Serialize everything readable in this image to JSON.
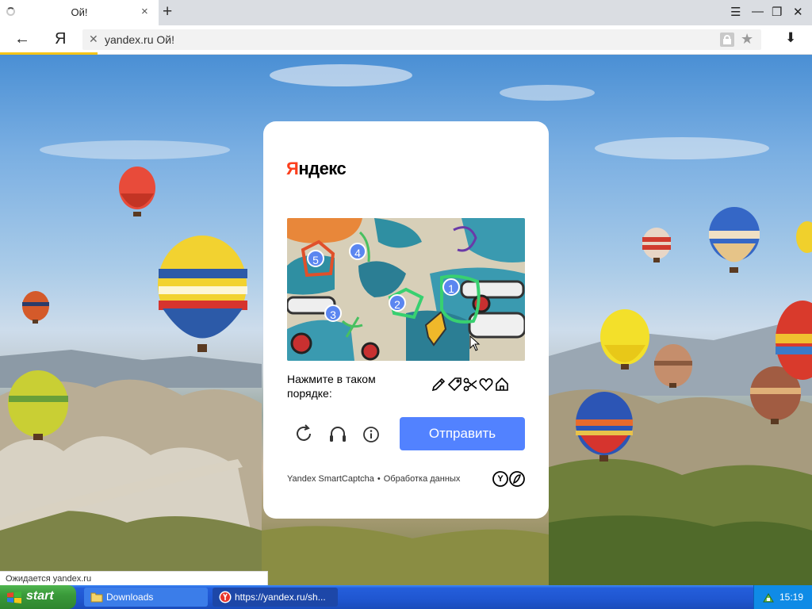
{
  "browser": {
    "tab_title": "Ой!",
    "tab_close": "×",
    "new_tab": "+",
    "window_buttons": {
      "menu": "☰",
      "minimize": "—",
      "restore": "❐",
      "close": "✕"
    },
    "back": "←",
    "yandex_button": "Я",
    "url_clear": "✕",
    "address_text": "yandex.ru Ой!",
    "bookmark": "★",
    "download": "⬇",
    "loading_progress": 0.12
  },
  "captcha": {
    "logo_first_letter": "Я",
    "logo_rest": "ндекс",
    "instruction": "Нажмите в таком порядке:",
    "sequence_icons": [
      "pencil-icon",
      "tag-icon",
      "scissors-icon",
      "heart-icon",
      "house-icon"
    ],
    "markers": [
      "1",
      "2",
      "3",
      "4",
      "5"
    ],
    "submit_label": "Отправить",
    "footer_brand": "Yandex SmartCaptcha",
    "footer_separator": "•",
    "footer_link": "Обработка данных",
    "footer_logo_letter": "Y",
    "colors": {
      "accent": "#5282ff",
      "marker": "#5b86f0",
      "logo_red": "#fc3f1d"
    }
  },
  "status_text": "Ожидается yandex.ru",
  "taskbar": {
    "start_label": "start",
    "tasks": [
      {
        "label": "Downloads",
        "icon": "folder-icon"
      },
      {
        "label": "https://yandex.ru/sh...",
        "icon": "yandex-browser-icon"
      }
    ],
    "clock": "15:19"
  }
}
